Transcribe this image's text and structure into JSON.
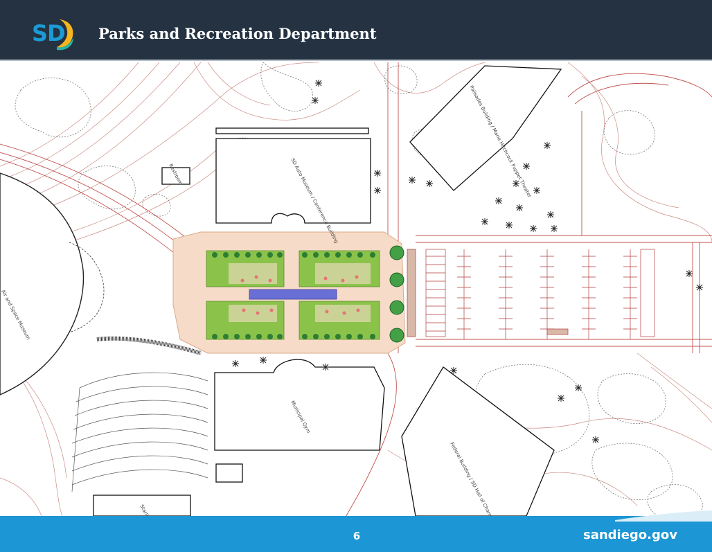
{
  "header": {
    "logo_text": "SD",
    "title": "Parks and Recreation Department"
  },
  "plan": {
    "labels": {
      "auto_museum": "SD Auto Museum / Conference Building",
      "restroom": "Restroom",
      "palisades": "Palisades Building / Marie Hitchcock Puppet Theater",
      "air_space": "Air and Space Museum",
      "gym": "Municipal Gym",
      "federal": "Federal Building / SD Hall of Champions",
      "starlight": "Starlight"
    }
  },
  "footer": {
    "page_number": "6",
    "site": "sandiego.gov"
  },
  "colors": {
    "header_bg": "#243242",
    "footer_bg": "#1c96d4",
    "plaza": "#f6dcc8",
    "lawn": "#8bc34a",
    "pool": "#6a6fd6",
    "contour": "#b86a5e"
  }
}
